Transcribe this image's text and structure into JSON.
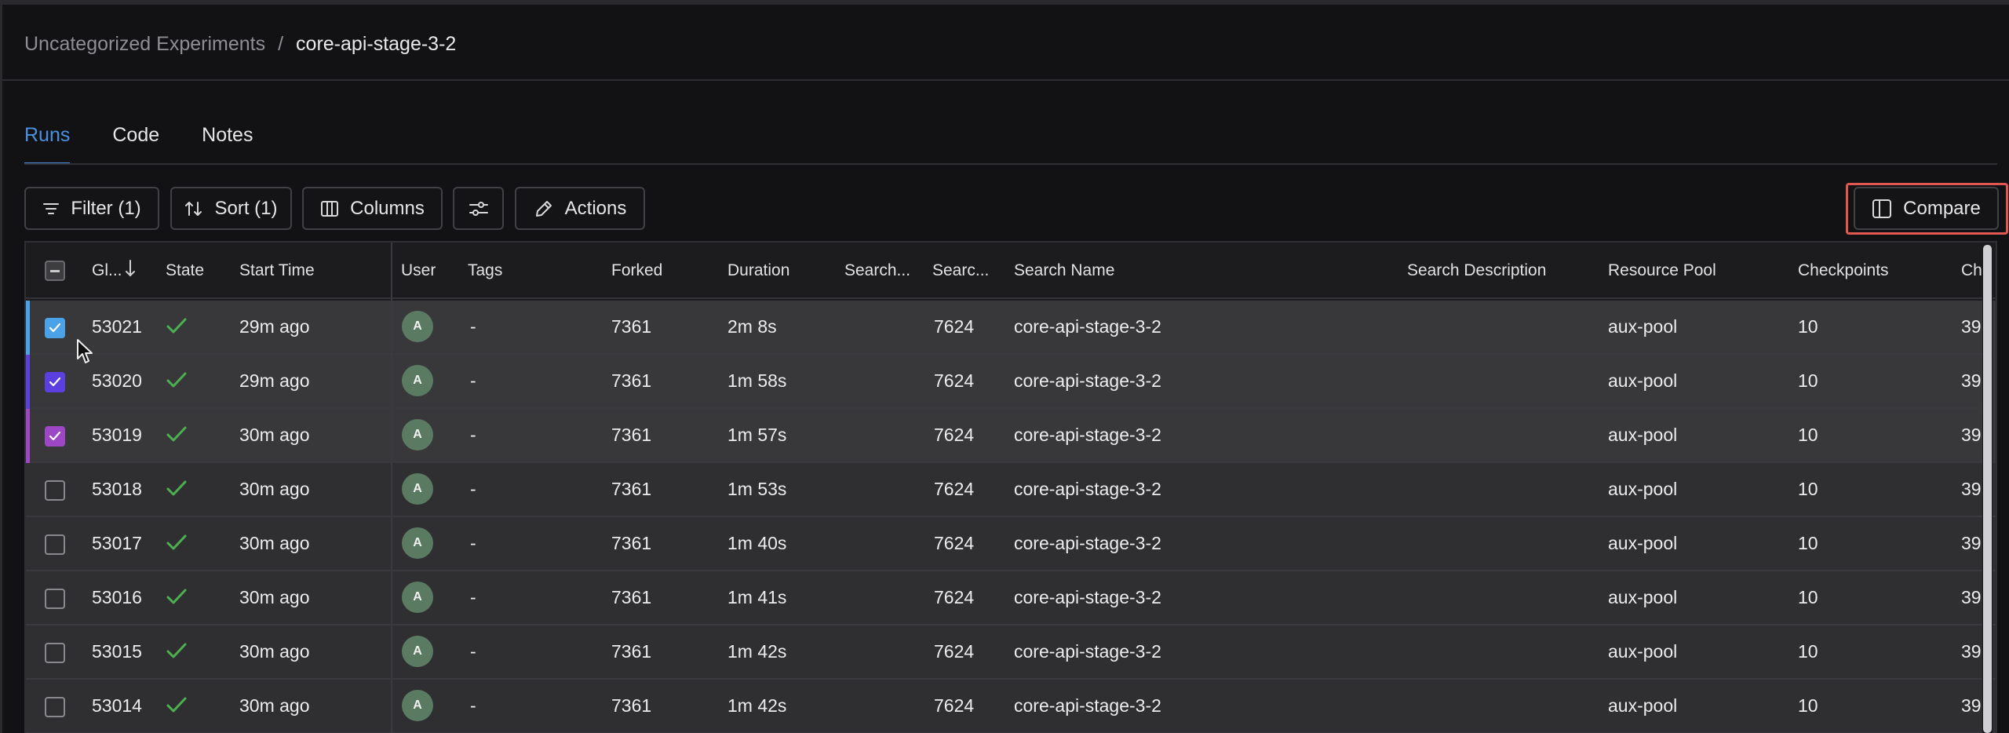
{
  "breadcrumb": {
    "parent": "Uncategorized Experiments",
    "separator": "/",
    "current": "core-api-stage-3-2"
  },
  "tabs": [
    {
      "label": "Runs",
      "active": true
    },
    {
      "label": "Code",
      "active": false
    },
    {
      "label": "Notes",
      "active": false
    }
  ],
  "toolbar": {
    "filter_label": "Filter (1)",
    "sort_label": "Sort (1)",
    "columns_label": "Columns",
    "actions_label": "Actions",
    "compare_label": "Compare"
  },
  "columns": {
    "global_id": "Gl...",
    "state": "State",
    "start_time": "Start Time",
    "user": "User",
    "tags": "Tags",
    "forked": "Forked",
    "duration": "Duration",
    "search_trunc1": "Search...",
    "search_trunc2": "Searc...",
    "search_name": "Search Name",
    "search_description": "Search Description",
    "resource_pool": "Resource Pool",
    "checkpoints": "Checkpoints",
    "next_trunc": "Ch"
  },
  "rows": [
    {
      "id": "53021",
      "start": "29m ago",
      "user": "A",
      "tags": "-",
      "forked": "7361",
      "duration": "2m 8s",
      "search_id": "7624",
      "search_name": "core-api-stage-3-2",
      "resource_pool": "aux-pool",
      "checkpoints": "10",
      "next": "39",
      "selected": true,
      "accent": "#4aa3e8"
    },
    {
      "id": "53020",
      "start": "29m ago",
      "user": "A",
      "tags": "-",
      "forked": "7361",
      "duration": "1m 58s",
      "search_id": "7624",
      "search_name": "core-api-stage-3-2",
      "resource_pool": "aux-pool",
      "checkpoints": "10",
      "next": "39",
      "selected": true,
      "accent": "#5b3fe0"
    },
    {
      "id": "53019",
      "start": "30m ago",
      "user": "A",
      "tags": "-",
      "forked": "7361",
      "duration": "1m 57s",
      "search_id": "7624",
      "search_name": "core-api-stage-3-2",
      "resource_pool": "aux-pool",
      "checkpoints": "10",
      "next": "39",
      "selected": true,
      "accent": "#9d46c6"
    },
    {
      "id": "53018",
      "start": "30m ago",
      "user": "A",
      "tags": "-",
      "forked": "7361",
      "duration": "1m 53s",
      "search_id": "7624",
      "search_name": "core-api-stage-3-2",
      "resource_pool": "aux-pool",
      "checkpoints": "10",
      "next": "39",
      "selected": false
    },
    {
      "id": "53017",
      "start": "30m ago",
      "user": "A",
      "tags": "-",
      "forked": "7361",
      "duration": "1m 40s",
      "search_id": "7624",
      "search_name": "core-api-stage-3-2",
      "resource_pool": "aux-pool",
      "checkpoints": "10",
      "next": "39",
      "selected": false
    },
    {
      "id": "53016",
      "start": "30m ago",
      "user": "A",
      "tags": "-",
      "forked": "7361",
      "duration": "1m 41s",
      "search_id": "7624",
      "search_name": "core-api-stage-3-2",
      "resource_pool": "aux-pool",
      "checkpoints": "10",
      "next": "39",
      "selected": false
    },
    {
      "id": "53015",
      "start": "30m ago",
      "user": "A",
      "tags": "-",
      "forked": "7361",
      "duration": "1m 42s",
      "search_id": "7624",
      "search_name": "core-api-stage-3-2",
      "resource_pool": "aux-pool",
      "checkpoints": "10",
      "next": "39",
      "selected": false
    },
    {
      "id": "53014",
      "start": "30m ago",
      "user": "A",
      "tags": "-",
      "forked": "7361",
      "duration": "1m 42s",
      "search_id": "7624",
      "search_name": "core-api-stage-3-2",
      "resource_pool": "aux-pool",
      "checkpoints": "10",
      "next": "39",
      "selected": false
    }
  ],
  "icons": {
    "filter": "filter-icon",
    "sort": "sort-icon",
    "columns": "columns-icon",
    "options": "sliders-icon",
    "actions": "pencil-icon",
    "compare": "split-panel-icon",
    "state": "check-icon",
    "cursor": "mouse-pointer-icon"
  },
  "colors": {
    "tab_active": "#4a90e2",
    "state_ok": "#4caf50",
    "compare_highlight": "#e0584f",
    "avatar": "#5a7a62"
  }
}
